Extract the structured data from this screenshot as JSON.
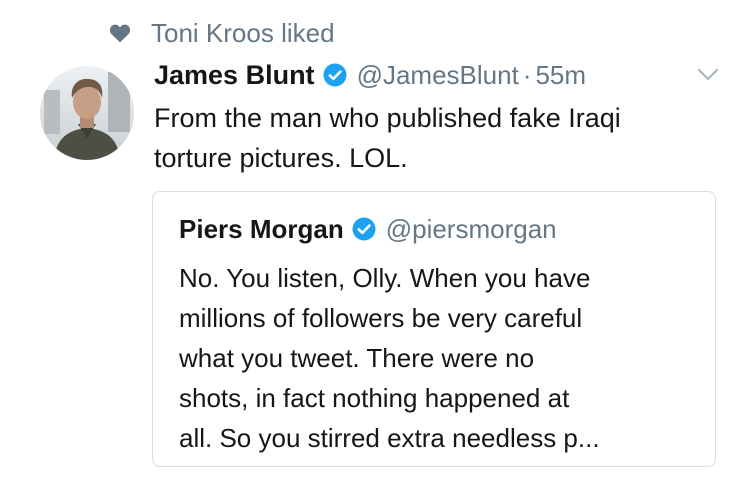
{
  "social_context": {
    "icon": "heart-icon",
    "text": "Toni Kroos liked"
  },
  "tweet": {
    "avatar": "avatar",
    "author_name": "James Blunt",
    "verified_icon": "verified-badge-icon",
    "handle": "@JamesBlunt",
    "separator": "·",
    "time": "55m",
    "menu_icon": "chevron-down-icon",
    "text": "From the man who published fake Iraqi\ntorture pictures. LOL."
  },
  "quoted_tweet": {
    "author_name": "Piers Morgan",
    "verified_icon": "verified-badge-icon",
    "handle": "@piersmorgan",
    "text": "No. You listen, Olly. When you have\nmillions of followers be very careful\nwhat you tweet. There were no\nshots, in fact nothing happened at\nall. So you stirred extra needless p..."
  },
  "colors": {
    "primary_text": "#14171a",
    "secondary_text": "#657786",
    "verified_blue": "#1da1f2",
    "card_border": "#d6dde3"
  }
}
